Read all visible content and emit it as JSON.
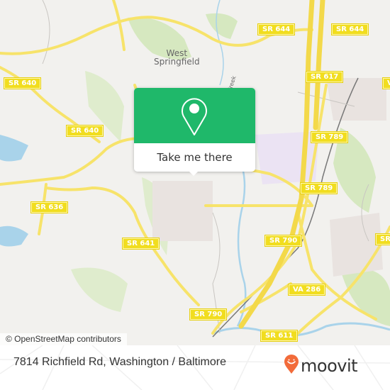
{
  "map": {
    "attribution": "© OpenStreetMap contributors",
    "place_labels": [
      {
        "id": "west-springfield",
        "line1": "West",
        "line2": "Springfield"
      },
      {
        "id": "creek",
        "text": "Creek"
      }
    ],
    "road_shields": [
      {
        "label": "SR 644"
      },
      {
        "label": "SR 644"
      },
      {
        "label": "SR 617"
      },
      {
        "label": "V"
      },
      {
        "label": "SR 640"
      },
      {
        "label": "SR 640"
      },
      {
        "label": "SR 789"
      },
      {
        "label": "SR 789"
      },
      {
        "label": "SR 636"
      },
      {
        "label": "SR 641"
      },
      {
        "label": "SR 790"
      },
      {
        "label": "SR"
      },
      {
        "label": "VA 286"
      },
      {
        "label": "SR 790"
      },
      {
        "label": "SR 611"
      }
    ],
    "colors": {
      "background": "#f2f1ee",
      "road": "#f7e36a",
      "park": "#d6e8c0",
      "water": "#a9d3ea",
      "industrial": "#ebe3f3",
      "residential": "#e9e3e0"
    }
  },
  "popup": {
    "icon": "map-pin-icon",
    "button_label": "Take me there",
    "color": "#1fb86a"
  },
  "footer": {
    "address": "7814 Richfield Rd, Washington / Baltimore",
    "brand": "moovit",
    "brand_icon": "moovit-pin-smiley-icon",
    "brand_color": "#f26b3a"
  }
}
